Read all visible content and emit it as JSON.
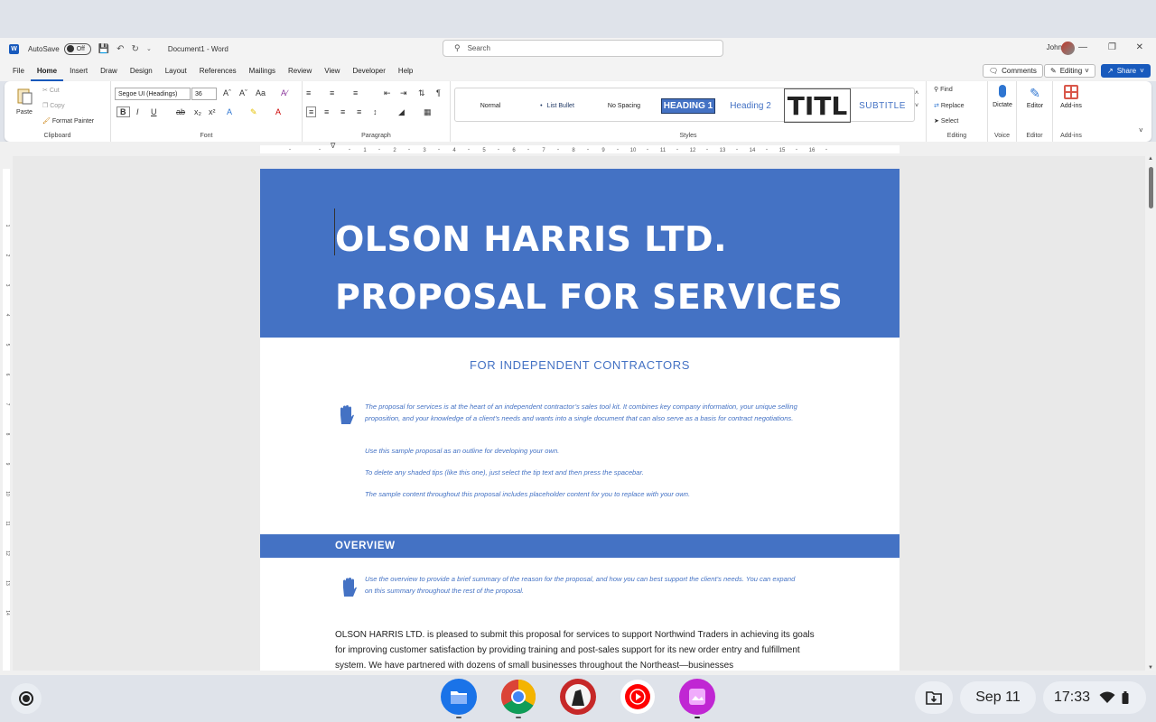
{
  "titlebar": {
    "autosave_label": "AutoSave",
    "autosave_state": "Off",
    "doc_title": "Document1 - Word",
    "search_placeholder": "Search",
    "user_name": "John"
  },
  "tabs": [
    "File",
    "Home",
    "Insert",
    "Draw",
    "Design",
    "Layout",
    "References",
    "Mailings",
    "Review",
    "View",
    "Developer",
    "Help"
  ],
  "active_tab": "Home",
  "top_buttons": {
    "comments": "Comments",
    "editing": "Editing",
    "share": "Share"
  },
  "ribbon": {
    "clipboard": {
      "paste": "Paste",
      "cut": "Cut",
      "copy": "Copy",
      "format_painter": "Format Painter",
      "label": "Clipboard"
    },
    "font": {
      "family": "Segoe UI (Headings)",
      "size": "36",
      "label": "Font"
    },
    "paragraph": {
      "label": "Paragraph"
    },
    "styles": {
      "label": "Styles",
      "items": [
        "Normal",
        "List Bullet",
        "No Spacing",
        "HEADING 1",
        "Heading 2",
        "TITL",
        "SUBTITLE"
      ]
    },
    "editing": {
      "find": "Find",
      "replace": "Replace",
      "select": "Select",
      "label": "Editing"
    },
    "voice": {
      "dictate": "Dictate",
      "label": "Voice"
    },
    "editor": {
      "editor": "Editor",
      "label": "Editor"
    },
    "addins": {
      "addins": "Add-ins",
      "label": "Add-ins"
    }
  },
  "ruler_numbers": [
    "1",
    "2",
    "3",
    "4",
    "5",
    "6",
    "7",
    "8",
    "9",
    "10",
    "11",
    "12",
    "13",
    "14",
    "15",
    "16"
  ],
  "vruler_numbers": [
    "1",
    "2",
    "3",
    "4",
    "5",
    "6",
    "7",
    "8",
    "9",
    "10",
    "11",
    "12",
    "13",
    "14"
  ],
  "document": {
    "title_line1": "OLSON HARRIS LTD.",
    "title_line2": "PROPOSAL FOR SERVICES",
    "subtitle": "FOR INDEPENDENT CONTRACTORS",
    "tips1": [
      "The proposal for services is at the heart of an independent contractor’s sales tool kit. It combines key company information, your unique selling proposition, and your knowledge of a client’s needs and wants into a single document that can also serve as a basis for contract negotiations.",
      "Use this sample proposal as an outline for developing your own.",
      "To delete any shaded tips (like this one), just select the tip text and then press the spacebar.",
      "The sample content throughout this proposal includes placeholder content for you to replace with your own."
    ],
    "section_heading": "OVERVIEW",
    "tip2": "Use the overview to provide a brief summary of the reason for the proposal, and how you can best support the client’s needs. You can expand on this summary throughout the rest of the proposal.",
    "body": "OLSON HARRIS LTD. is pleased to submit this proposal for services to support Northwind Traders in achieving its goals for improving customer satisfaction by providing training and post-sales support for its new order entry and fulfillment system. We have partnered with dozens of small businesses throughout the Northeast—businesses"
  },
  "shelf": {
    "date": "Sep 11",
    "time": "17:33"
  },
  "colors": {
    "accent": "#4472c4",
    "word_blue": "#185abd"
  }
}
